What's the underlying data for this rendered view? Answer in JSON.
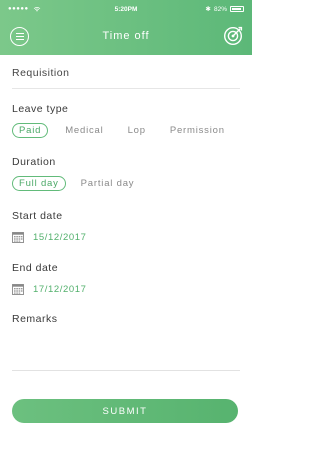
{
  "status_bar": {
    "signal": "●●●●●",
    "time": "5:20PM",
    "bluetooth": "✱",
    "battery_text": "82%"
  },
  "nav": {
    "title": "Time off",
    "menu_icon": "menu-icon",
    "target_icon": "target-icon"
  },
  "form": {
    "requisition_label": "Requisition",
    "leave_type": {
      "label": "Leave type",
      "options": [
        "Paid",
        "Medical",
        "Lop",
        "Permission"
      ],
      "selected": "Paid"
    },
    "duration": {
      "label": "Duration",
      "options": [
        "Full day",
        "Partial day"
      ],
      "selected": "Full day"
    },
    "start_date": {
      "label": "Start date",
      "value": "15/12/2017"
    },
    "end_date": {
      "label": "End date",
      "value": "17/12/2017"
    },
    "remarks_label": "Remarks"
  },
  "submit_label": "SUBMIT",
  "colors": {
    "accent": "#5cb878",
    "accent_light": "#7cc88a",
    "text_muted": "#8a8a8a"
  }
}
